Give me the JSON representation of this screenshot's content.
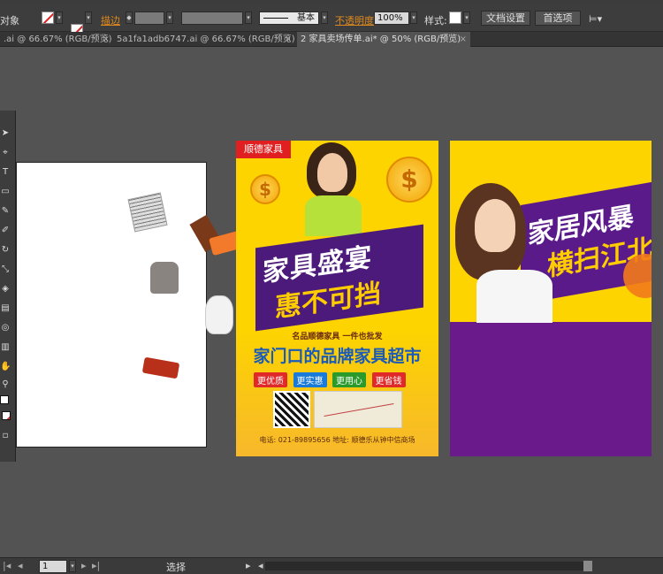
{
  "control_bar": {
    "selection_label": "对象",
    "stroke_label": "描边",
    "stroke_style": "基本",
    "opacity_label": "不透明度",
    "opacity_value": "100%",
    "style_label": "样式:",
    "doc_setup_button": "文档设置",
    "preferences_button": "首选项"
  },
  "tabs": [
    {
      "label": ".ai @ 66.67% (RGB/预览)",
      "close": "×"
    },
    {
      "label": "5a1fa1adb6747.ai @ 66.67% (RGB/预览)",
      "close": "×"
    },
    {
      "label": "2 家具卖场传单.ai* @ 50% (RGB/预览)",
      "close": "×"
    }
  ],
  "poster1": {
    "brand": "顺德家具",
    "headline_1": "家具盛宴",
    "headline_2": "惠不可挡",
    "subline": "名品顺德家具 一件也批发",
    "slogan": "家门口的品牌家具超市",
    "tags": [
      "更优质",
      "更实惠",
      "更用心",
      "更省钱"
    ],
    "contact": "电话: 021-89895656 地址: 顺德乐从钟中信商场",
    "coin_symbol": "$"
  },
  "poster2": {
    "headline_1": "家居风暴",
    "headline_2": "横扫江北"
  },
  "status_bar": {
    "artboard_number": "1",
    "tool_label": "选择"
  },
  "colors": {
    "poster_yellow": "#fdd400",
    "poster_purple": "#6a1a8a",
    "brand_red": "#e02020"
  }
}
